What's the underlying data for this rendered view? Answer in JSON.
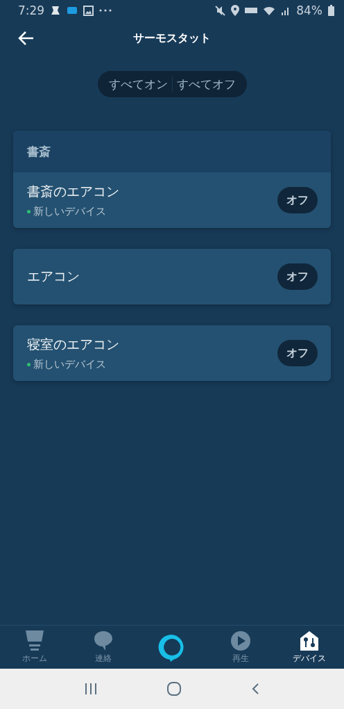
{
  "status_bar": {
    "time": "7:29",
    "battery": "84%"
  },
  "header": {
    "title": "サーモスタット"
  },
  "bulk_toggle": [
    {
      "label": "すべてオン"
    },
    {
      "label": "すべてオフ"
    }
  ],
  "cards": [
    {
      "title": "書斎",
      "devices": [
        {
          "name": "書斎のエアコン",
          "subtitle": "新しいデバイス",
          "action": "オフ"
        }
      ]
    },
    {
      "devices": [
        {
          "name": "エアコン",
          "action": "オフ"
        }
      ]
    },
    {
      "devices": [
        {
          "name": "寝室のエアコン",
          "subtitle": "新しいデバイス",
          "action": "オフ"
        }
      ]
    }
  ],
  "bottom_nav": [
    {
      "kind": "home",
      "label": "ホーム",
      "selected": false
    },
    {
      "kind": "chat",
      "label": "連絡",
      "selected": false
    },
    {
      "kind": "alexa",
      "selected": false
    },
    {
      "kind": "play",
      "label": "再生",
      "selected": false
    },
    {
      "kind": "devices",
      "label": "デバイス",
      "selected": true
    }
  ]
}
